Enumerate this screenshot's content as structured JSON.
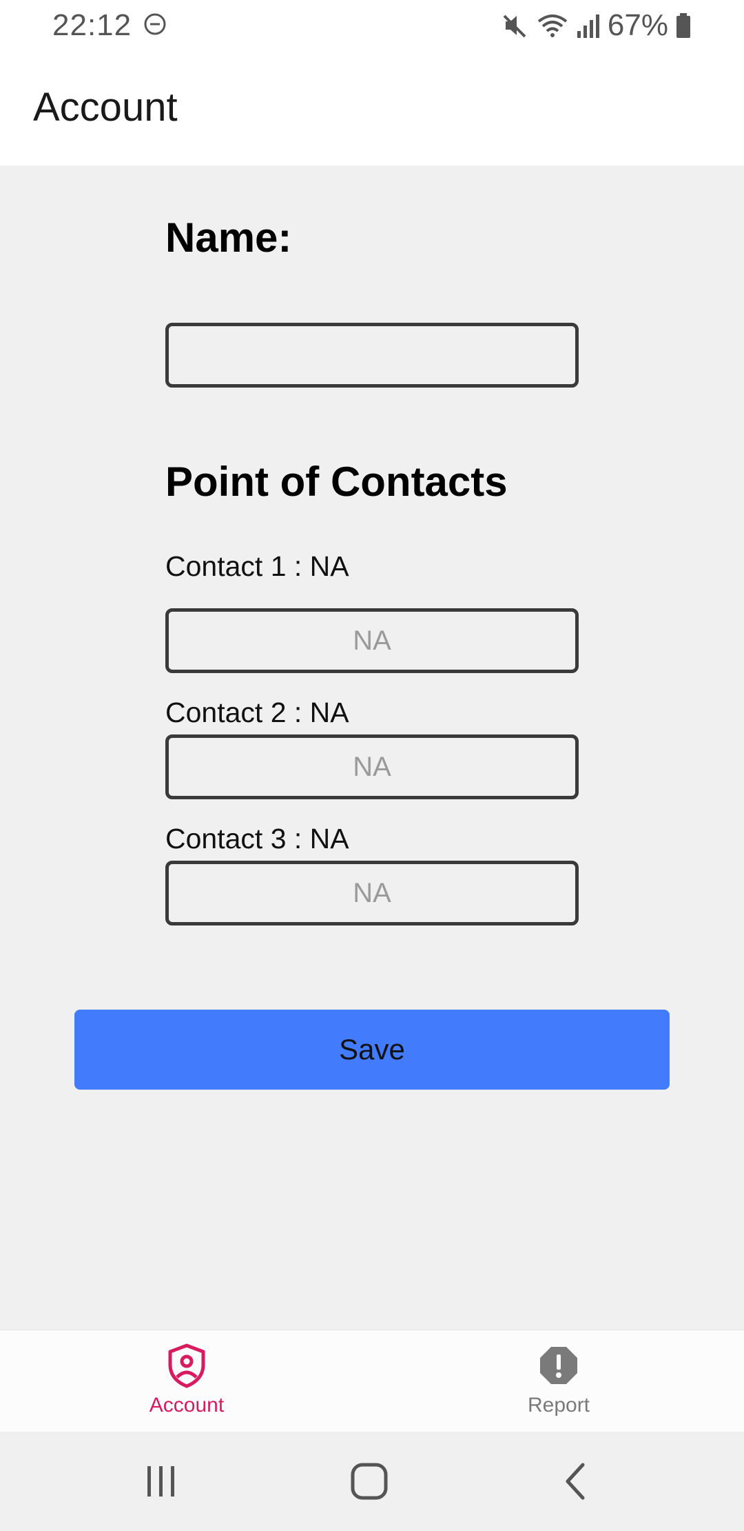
{
  "status_bar": {
    "time": "22:12",
    "battery_percent": "67%",
    "icons": [
      "do-not-disturb-icon",
      "mute-icon",
      "wifi-icon",
      "signal-icon",
      "battery-icon"
    ]
  },
  "app_bar": {
    "title": "Account"
  },
  "form": {
    "name_label": "Name:",
    "name_value": "",
    "poc_heading": "Point of Contacts",
    "contacts": [
      {
        "label": "Contact 1 : NA",
        "placeholder": "NA",
        "value": ""
      },
      {
        "label": "Contact 2 : NA",
        "placeholder": "NA",
        "value": ""
      },
      {
        "label": "Contact 3 : NA",
        "placeholder": "NA",
        "value": ""
      }
    ],
    "save_label": "Save"
  },
  "bottom_nav": {
    "items": [
      {
        "label": "Account",
        "icon": "shield-user-icon",
        "active": true
      },
      {
        "label": "Report",
        "icon": "alert-octagon-icon",
        "active": false
      }
    ]
  },
  "colors": {
    "accent": "#d81b60",
    "primary_button": "#437bfd",
    "background": "#f0f0f0",
    "inactive": "#7a7a7a"
  }
}
